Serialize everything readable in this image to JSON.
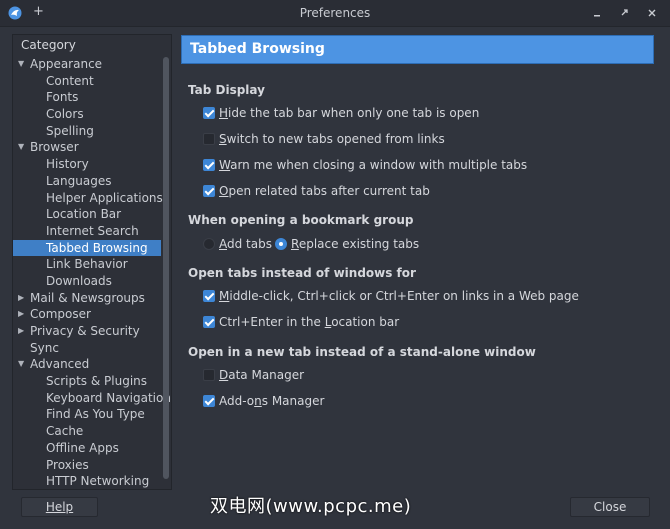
{
  "window": {
    "title": "Preferences",
    "pin_glyph": "+"
  },
  "sidebar": {
    "header": "Category",
    "items": [
      {
        "label": "Appearance",
        "level": 0,
        "expanded": true
      },
      {
        "label": "Content",
        "level": 1
      },
      {
        "label": "Fonts",
        "level": 1
      },
      {
        "label": "Colors",
        "level": 1
      },
      {
        "label": "Spelling",
        "level": 1
      },
      {
        "label": "Browser",
        "level": 0,
        "expanded": true
      },
      {
        "label": "History",
        "level": 1
      },
      {
        "label": "Languages",
        "level": 1
      },
      {
        "label": "Helper Applications",
        "level": 1
      },
      {
        "label": "Location Bar",
        "level": 1
      },
      {
        "label": "Internet Search",
        "level": 1
      },
      {
        "label": "Tabbed Browsing",
        "level": 1,
        "selected": true
      },
      {
        "label": "Link Behavior",
        "level": 1
      },
      {
        "label": "Downloads",
        "level": 1
      },
      {
        "label": "Mail & Newsgroups",
        "level": 0,
        "expanded": false
      },
      {
        "label": "Composer",
        "level": 0,
        "expanded": false
      },
      {
        "label": "Privacy & Security",
        "level": 0,
        "expanded": false
      },
      {
        "label": "Sync",
        "level": 0
      },
      {
        "label": "Advanced",
        "level": 0,
        "expanded": true
      },
      {
        "label": "Scripts & Plugins",
        "level": 1
      },
      {
        "label": "Keyboard Navigation",
        "level": 1
      },
      {
        "label": "Find As You Type",
        "level": 1
      },
      {
        "label": "Cache",
        "level": 1
      },
      {
        "label": "Offline Apps",
        "level": 1
      },
      {
        "label": "Proxies",
        "level": 1
      },
      {
        "label": "HTTP Networking",
        "level": 1
      }
    ]
  },
  "content": {
    "title": "Tabbed Browsing",
    "tab_display": {
      "title": "Tab Display",
      "opt1": {
        "pre": "",
        "u": "H",
        "post": "ide the tab bar when only one tab is open",
        "checked": true
      },
      "opt2": {
        "pre": "",
        "u": "S",
        "post": "witch to new tabs opened from links",
        "checked": false
      },
      "opt3": {
        "pre": "",
        "u": "W",
        "post": "arn me when closing a window with multiple tabs",
        "checked": true
      },
      "opt4": {
        "pre": "",
        "u": "O",
        "post": "pen related tabs after current tab",
        "checked": true
      }
    },
    "bookmark_group": {
      "title": "When opening a bookmark group",
      "opt1": {
        "pre": "",
        "u": "A",
        "post": "dd tabs",
        "selected": false
      },
      "opt2": {
        "pre": "",
        "u": "R",
        "post": "eplace existing tabs",
        "selected": true
      }
    },
    "tabs_instead": {
      "title": "Open tabs instead of windows for",
      "opt1": {
        "pre": "",
        "u": "M",
        "post": "iddle-click, Ctrl+click or Ctrl+Enter on links in a Web page",
        "checked": true
      },
      "opt2": {
        "pre": "Ctrl+Enter in the ",
        "u": "L",
        "post": "ocation bar",
        "checked": true
      }
    },
    "new_tab_instead": {
      "title": "Open in a new tab instead of a stand-alone window",
      "opt1": {
        "pre": "",
        "u": "D",
        "post": "ata Manager",
        "checked": false
      },
      "opt2": {
        "pre": "Add-o",
        "u": "n",
        "post": "s Manager",
        "checked": true
      }
    }
  },
  "buttons": {
    "help": "Help",
    "close": "Close"
  },
  "watermark": "双电网(www.pcpc.me)"
}
